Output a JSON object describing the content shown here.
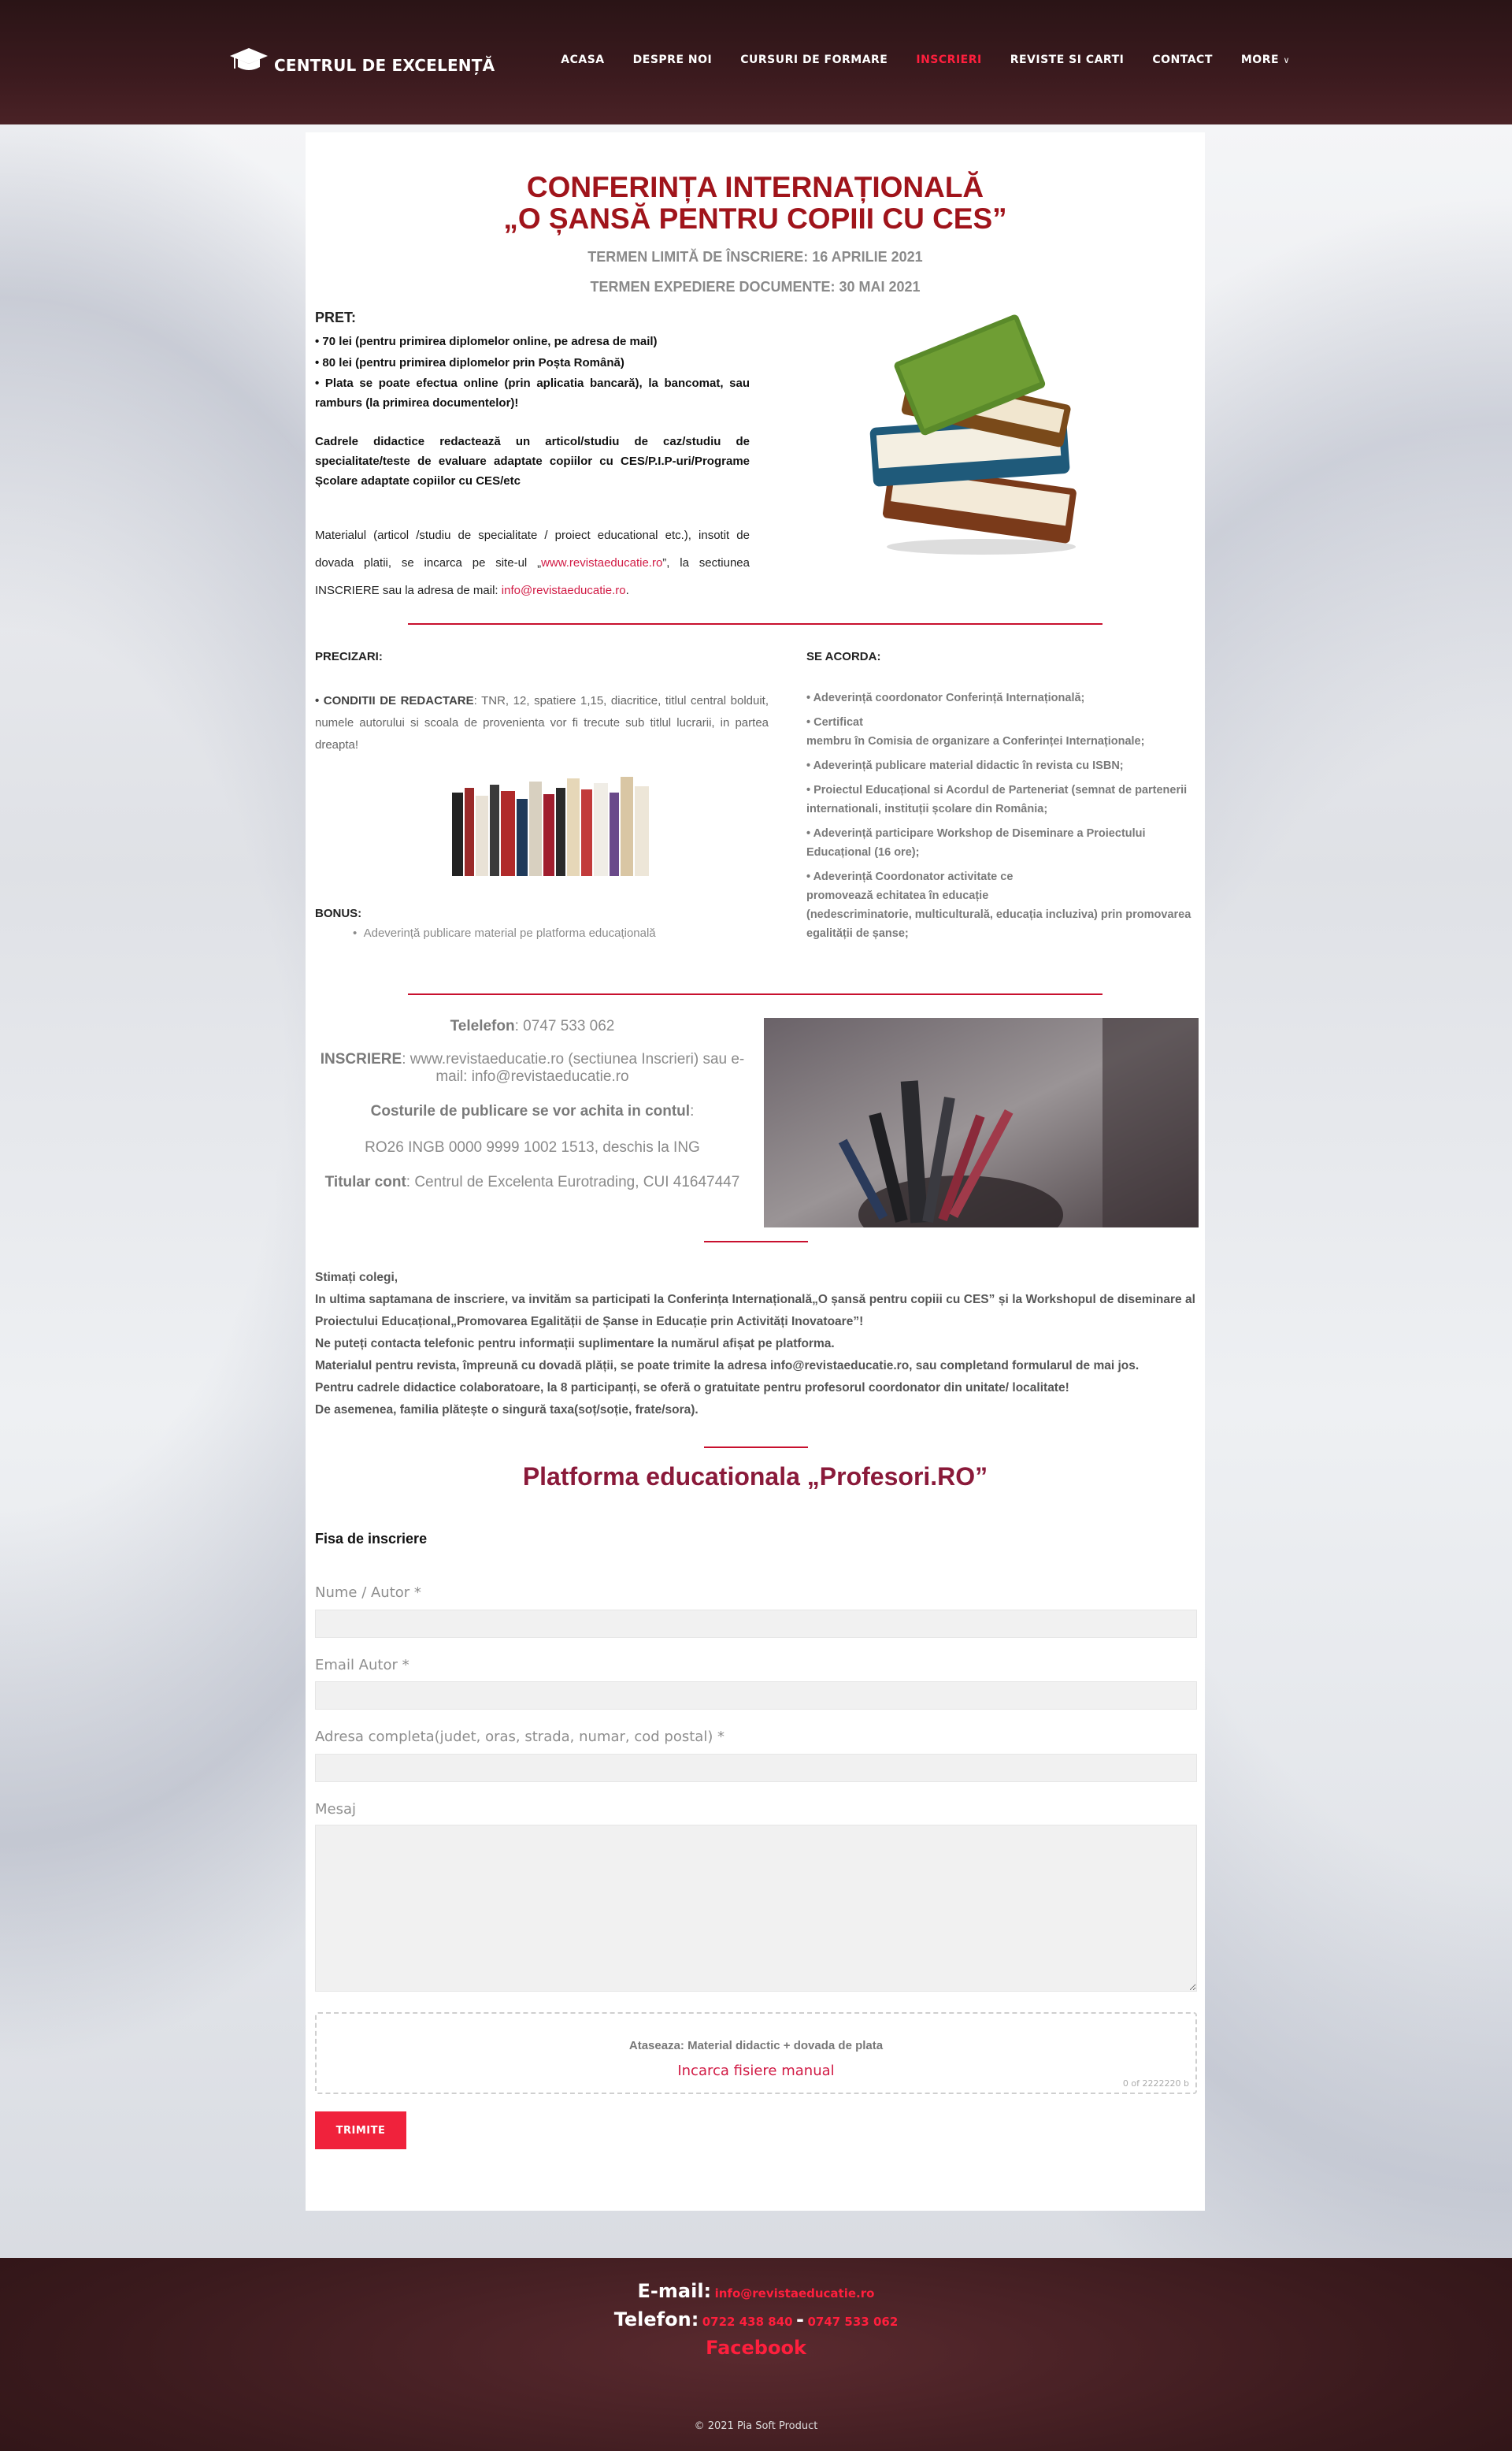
{
  "header": {
    "logo_text": "CENTRUL DE EXCELENȚĂ",
    "nav": [
      "ACASA",
      "DESPRE NOI",
      "CURSURI DE FORMARE",
      "INSCRIERI",
      "REVISTE SI CARTI",
      "CONTACT",
      "MORE"
    ],
    "active_nav": "INSCRIERI"
  },
  "conference": {
    "title_line1": "CONFERINȚA INTERNAȚIONALĂ",
    "title_line2": "„O ȘANSĂ PENTRU COPIII CU CES”",
    "deadline1": "TERMEN LIMITĂ DE ÎNSCRIERE: 16 APRILIE 2021",
    "deadline2": "TERMEN EXPEDIERE DOCUMENTE: 30 MAI 2021"
  },
  "pret": {
    "title": "PRET:",
    "items": [
      "•  70 lei (pentru primirea diplomelor online, pe adresa de mail)",
      "•  80 lei (pentru primirea diplomelor prin Poșta Română)",
      "•  Plata se poate efectua online (prin aplicatia bancară), la bancomat, sau ramburs (la primirea documentelor)!"
    ],
    "cadre": "Cadrele didactice redactează un articol/studiu de caz/studiu de specialitate/teste de evaluare adaptate copiilor cu CES/P.I.P-uri/Programe Școlare adaptate copiilor cu CES/etc",
    "material_pre": "Materialul (articol /studiu de specialitate / proiect educational etc.), insotit de dovada platii, se incarca pe site-ul „",
    "material_link": "www.revistaeducatie.ro",
    "material_mid": "”, la sectiunea INSCRIERE sau la adresa de mail: ",
    "material_mail": "info@revistaeducatie.ro",
    "material_end": "."
  },
  "precizari": {
    "title": "PRECIZARI:",
    "bold": "• CONDITII DE REDACTARE",
    "text": ": TNR, 12, spatiere 1,15, diacritice, titlul central bolduit, numele autorului si scoala de provenienta vor fi trecute sub titlul lucrarii, in partea dreapta!",
    "bonus_title": "BONUS:",
    "bonus_item": "Adeverință  publicare material pe platforma educațională"
  },
  "acorda": {
    "title": "SE ACORDA:",
    "items": [
      "•  Adeverință coordonator Conferință Internațională;",
      "•  Certificat\nmembru în Comisia de organizare a Conferinței Internaționale;",
      "•  Adeverință publicare material didactic în revista cu ISBN;",
      "•  Proiectul Educațional si Acordul de Parteneriat (semnat de partenerii internationali, instituții școlare din România;",
      "•  Adeverință participare Workshop de Diseminare a Proiectului Educațional (16 ore);",
      "•  Adeverință Coordonator activitate ce\npromovează echitatea în educație\n(nedescriminatorie, multiculturală, educația incluziva) prin promovarea egalității de șanse;"
    ]
  },
  "contact": {
    "phone_label": "Telelefon",
    "phone": ": 0747 533 062",
    "inscriere_label": "INSCRIERE",
    "inscriere": ": www.revistaeducatie.ro (sectiunea Inscrieri) sau e-mail: info@revistaeducatie.ro",
    "costuri": "Costurile de publicare se vor achita in contul",
    "costuri_end": ":",
    "iban": "RO26 INGB 0000 9999 1002 1513, deschis la ING",
    "titular_label": "Titular cont",
    "titular": ": Centrul de Excelenta Eurotrading, CUI 41647447"
  },
  "letter": {
    "lines": [
      "Stimați colegi,",
      "In ultima saptamana de inscriere, va invităm sa participati la Conferința Internațională„O șansă pentru copiii cu CES” și la Workshopul de diseminare al Proiectului Educațional„Promovarea Egalității de Șanse in Educație prin Activități Inovatoare”!",
      "Ne puteți contacta telefonic pentru informații suplimentare la numărul afișat pe platforma.",
      "Materialul pentru revista, împreună cu dovadă plății, se poate trimite la adresa info@revistaeducatie.ro, sau completand formularul de mai jos.",
      "Pentru cadrele didactice colaboratoare, la 8 participanți, se oferă o gratuitate pentru profesorul coordonator din unitate/ localitate!",
      "De asemenea, familia plătește o singură taxa(soț/soție, frate/sora)."
    ]
  },
  "form": {
    "platform_title": "Platforma educationala „Profesori.RO”",
    "fisa": "Fisa de inscriere",
    "name_label": "Nume / Autor *",
    "email_label": "Email Autor *",
    "address_label": "Adresa completa(judet, oras, strada, numar, cod postal) *",
    "message_label": "Mesaj",
    "upload_title": "Ataseaza: Material didactic + dovada de plata",
    "upload_link": "Incarca fisiere manual",
    "upload_count": "0 of 2222220 b",
    "submit": "TRIMITE"
  },
  "footer": {
    "email_label": "E-mail:",
    "email": "info@revistaeducatie.ro",
    "phone_label": "Telefon:",
    "phone1": "0722 438 840",
    "dash": "-",
    "phone2": "0747 533 062",
    "facebook": "Facebook",
    "copyright": "© 2021 Pia Soft Product"
  },
  "colors": {
    "accent_red": "#c8102e",
    "nav_active": "#ff1f3d",
    "title_red": "#a0141b",
    "platform_title": "#8a1a3a",
    "header_bg": "#3b1a1e"
  }
}
